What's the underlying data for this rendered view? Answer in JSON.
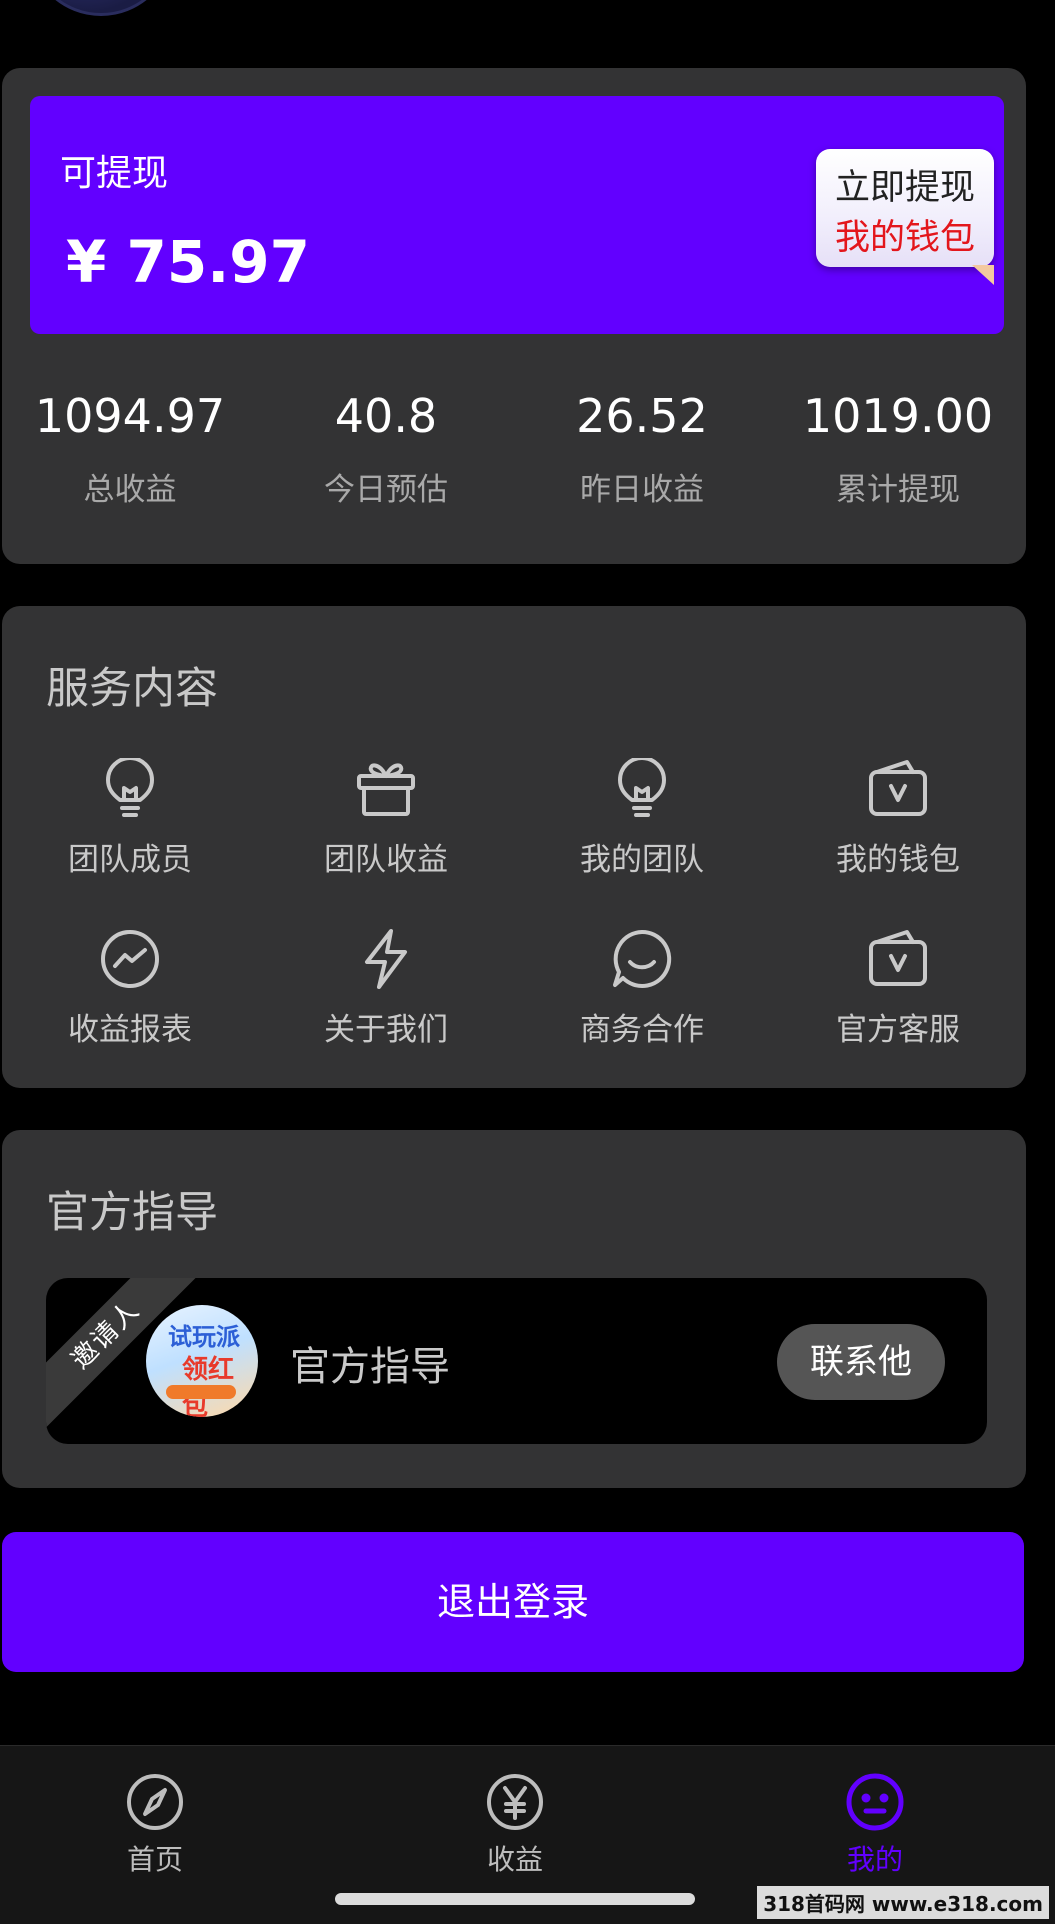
{
  "earnings": {
    "withdrawable_label": "可提现",
    "withdrawable_amount": "¥ 75.97",
    "withdraw_button_line1": "立即提现",
    "withdraw_button_line2": "我的钱包",
    "stats": [
      {
        "value": "1094.97",
        "label": "总收益"
      },
      {
        "value": "40.8",
        "label": "今日预估"
      },
      {
        "value": "26.52",
        "label": "昨日收益"
      },
      {
        "value": "1019.00",
        "label": "累计提现"
      }
    ]
  },
  "services": {
    "title": "服务内容",
    "items": [
      {
        "label": "团队成员",
        "icon": "lightbulb-icon"
      },
      {
        "label": "团队收益",
        "icon": "gift-icon"
      },
      {
        "label": "我的团队",
        "icon": "lightbulb-icon"
      },
      {
        "label": "我的钱包",
        "icon": "wallet-icon"
      },
      {
        "label": "收益报表",
        "icon": "chart-icon"
      },
      {
        "label": "关于我们",
        "icon": "lightning-icon"
      },
      {
        "label": "商务合作",
        "icon": "chat-icon"
      },
      {
        "label": "官方客服",
        "icon": "wallet-icon"
      }
    ]
  },
  "guide": {
    "title": "官方指导",
    "ribbon": "邀请人",
    "name": "官方指导",
    "contact_button": "联系他",
    "avatar_text1": "试玩派",
    "avatar_text2": "领红包"
  },
  "logout_label": "退出登录",
  "tabbar": {
    "items": [
      {
        "label": "首页",
        "icon": "compass-icon",
        "active": false
      },
      {
        "label": "收益",
        "icon": "yen-icon",
        "active": false
      },
      {
        "label": "我的",
        "icon": "smile-icon",
        "active": true
      }
    ]
  },
  "watermark": "318首码网 www.e318.com",
  "colors": {
    "accent": "#6200ff",
    "card": "#333334",
    "background": "#000000"
  }
}
